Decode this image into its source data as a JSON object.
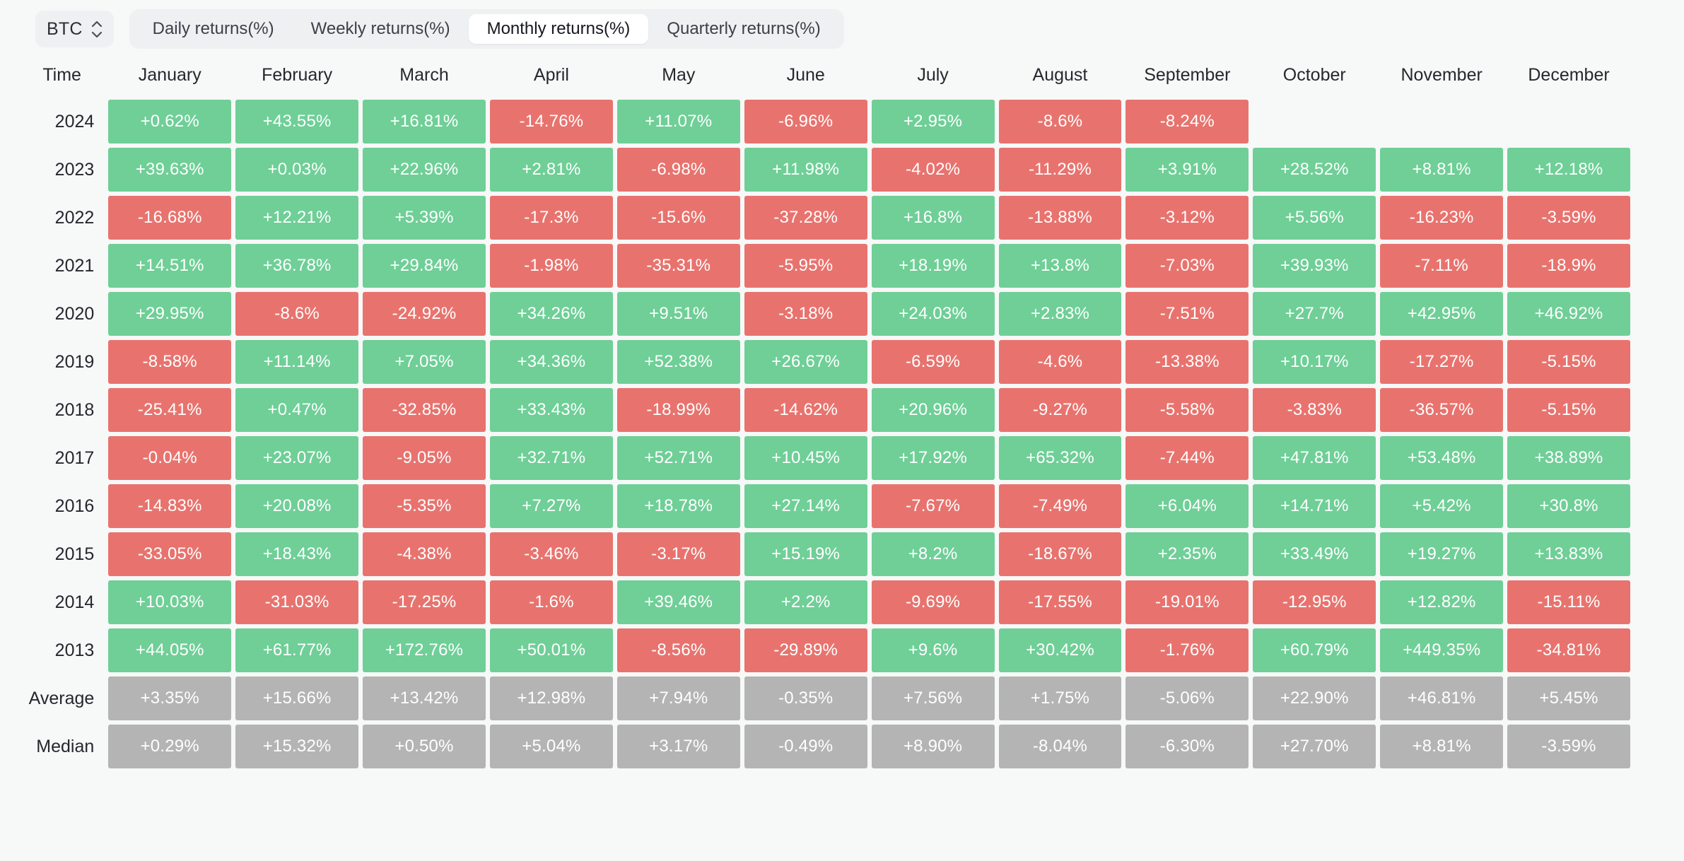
{
  "toolbar": {
    "asset": {
      "label": "BTC",
      "icon": "stepper-up-down-icon"
    },
    "tabs": [
      {
        "label": "Daily returns(%)",
        "active": false
      },
      {
        "label": "Weekly returns(%)",
        "active": false
      },
      {
        "label": "Monthly returns(%)",
        "active": true
      },
      {
        "label": "Quarterly returns(%)",
        "active": false
      }
    ]
  },
  "colors": {
    "positive": "#6fcf97",
    "negative": "#e8736e",
    "neutral": "#b4b4b4",
    "page_background": "#f7f8f8",
    "tabbar_background": "#eff0f2",
    "active_tab_background": "#ffffff"
  },
  "chart_data": {
    "type": "heatmap",
    "title": "Monthly returns(%)",
    "asset": "BTC",
    "xlabel": "Time",
    "categories": [
      "January",
      "February",
      "March",
      "April",
      "May",
      "June",
      "July",
      "August",
      "September",
      "October",
      "November",
      "December"
    ],
    "row_header": "Time",
    "rows": [
      {
        "label": "2024",
        "kind": "year",
        "values": [
          "+0.62%",
          "+43.55%",
          "+16.81%",
          "-14.76%",
          "+11.07%",
          "-6.96%",
          "+2.95%",
          "-8.6%",
          "-8.24%",
          "",
          "",
          ""
        ]
      },
      {
        "label": "2023",
        "kind": "year",
        "values": [
          "+39.63%",
          "+0.03%",
          "+22.96%",
          "+2.81%",
          "-6.98%",
          "+11.98%",
          "-4.02%",
          "-11.29%",
          "+3.91%",
          "+28.52%",
          "+8.81%",
          "+12.18%"
        ]
      },
      {
        "label": "2022",
        "kind": "year",
        "values": [
          "-16.68%",
          "+12.21%",
          "+5.39%",
          "-17.3%",
          "-15.6%",
          "-37.28%",
          "+16.8%",
          "-13.88%",
          "-3.12%",
          "+5.56%",
          "-16.23%",
          "-3.59%"
        ]
      },
      {
        "label": "2021",
        "kind": "year",
        "values": [
          "+14.51%",
          "+36.78%",
          "+29.84%",
          "-1.98%",
          "-35.31%",
          "-5.95%",
          "+18.19%",
          "+13.8%",
          "-7.03%",
          "+39.93%",
          "-7.11%",
          "-18.9%"
        ]
      },
      {
        "label": "2020",
        "kind": "year",
        "values": [
          "+29.95%",
          "-8.6%",
          "-24.92%",
          "+34.26%",
          "+9.51%",
          "-3.18%",
          "+24.03%",
          "+2.83%",
          "-7.51%",
          "+27.7%",
          "+42.95%",
          "+46.92%"
        ]
      },
      {
        "label": "2019",
        "kind": "year",
        "values": [
          "-8.58%",
          "+11.14%",
          "+7.05%",
          "+34.36%",
          "+52.38%",
          "+26.67%",
          "-6.59%",
          "-4.6%",
          "-13.38%",
          "+10.17%",
          "-17.27%",
          "-5.15%"
        ]
      },
      {
        "label": "2018",
        "kind": "year",
        "values": [
          "-25.41%",
          "+0.47%",
          "-32.85%",
          "+33.43%",
          "-18.99%",
          "-14.62%",
          "+20.96%",
          "-9.27%",
          "-5.58%",
          "-3.83%",
          "-36.57%",
          "-5.15%"
        ]
      },
      {
        "label": "2017",
        "kind": "year",
        "values": [
          "-0.04%",
          "+23.07%",
          "-9.05%",
          "+32.71%",
          "+52.71%",
          "+10.45%",
          "+17.92%",
          "+65.32%",
          "-7.44%",
          "+47.81%",
          "+53.48%",
          "+38.89%"
        ]
      },
      {
        "label": "2016",
        "kind": "year",
        "values": [
          "-14.83%",
          "+20.08%",
          "-5.35%",
          "+7.27%",
          "+18.78%",
          "+27.14%",
          "-7.67%",
          "-7.49%",
          "+6.04%",
          "+14.71%",
          "+5.42%",
          "+30.8%"
        ]
      },
      {
        "label": "2015",
        "kind": "year",
        "values": [
          "-33.05%",
          "+18.43%",
          "-4.38%",
          "-3.46%",
          "-3.17%",
          "+15.19%",
          "+8.2%",
          "-18.67%",
          "+2.35%",
          "+33.49%",
          "+19.27%",
          "+13.83%"
        ]
      },
      {
        "label": "2014",
        "kind": "year",
        "values": [
          "+10.03%",
          "-31.03%",
          "-17.25%",
          "-1.6%",
          "+39.46%",
          "+2.2%",
          "-9.69%",
          "-17.55%",
          "-19.01%",
          "-12.95%",
          "+12.82%",
          "-15.11%"
        ]
      },
      {
        "label": "2013",
        "kind": "year",
        "values": [
          "+44.05%",
          "+61.77%",
          "+172.76%",
          "+50.01%",
          "-8.56%",
          "-29.89%",
          "+9.6%",
          "+30.42%",
          "-1.76%",
          "+60.79%",
          "+449.35%",
          "-34.81%"
        ]
      },
      {
        "label": "Average",
        "kind": "summary",
        "values": [
          "+3.35%",
          "+15.66%",
          "+13.42%",
          "+12.98%",
          "+7.94%",
          "-0.35%",
          "+7.56%",
          "+1.75%",
          "-5.06%",
          "+22.90%",
          "+46.81%",
          "+5.45%"
        ]
      },
      {
        "label": "Median",
        "kind": "summary",
        "values": [
          "+0.29%",
          "+15.32%",
          "+0.50%",
          "+5.04%",
          "+3.17%",
          "-0.49%",
          "+8.90%",
          "-8.04%",
          "-6.30%",
          "+27.70%",
          "+8.81%",
          "-3.59%"
        ]
      }
    ]
  }
}
